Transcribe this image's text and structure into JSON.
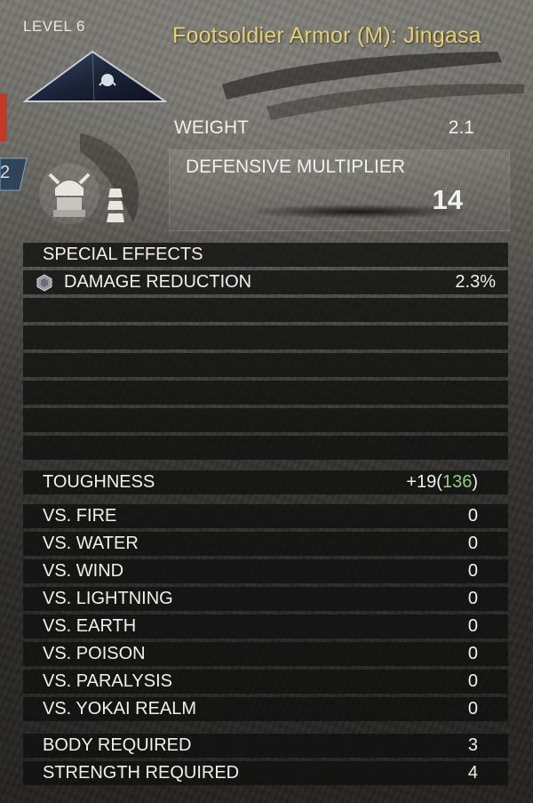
{
  "item": {
    "level_label": "LEVEL 6",
    "title": "Footsoldier Armor (M): Jingasa",
    "side_badge": "2"
  },
  "stats": {
    "weight_label": "WEIGHT",
    "weight_value": "2.1",
    "defense_label": "DEFENSIVE MULTIPLIER",
    "defense_value": "14"
  },
  "special_effects": {
    "header": "SPECIAL EFFECTS",
    "effects": [
      {
        "label": "DAMAGE REDUCTION",
        "value": "2.3%",
        "icon": "effect-gem-icon"
      }
    ]
  },
  "toughness": {
    "label": "TOUGHNESS",
    "bonus": "+19",
    "open_paren": "(",
    "total": "136",
    "close_paren": ")"
  },
  "resistances": [
    {
      "label": "VS. FIRE",
      "value": "0"
    },
    {
      "label": "VS. WATER",
      "value": "0"
    },
    {
      "label": "VS. WIND",
      "value": "0"
    },
    {
      "label": "VS. LIGHTNING",
      "value": "0"
    },
    {
      "label": "VS. EARTH",
      "value": "0"
    },
    {
      "label": "VS. POISON",
      "value": "0"
    },
    {
      "label": "VS. PARALYSIS",
      "value": "0"
    },
    {
      "label": "VS. YOKAI REALM",
      "value": "0"
    }
  ],
  "requirements": [
    {
      "label": "BODY REQUIRED",
      "value": "3"
    },
    {
      "label": "STRENGTH REQUIRED",
      "value": "4"
    }
  ],
  "colors": {
    "title_gold": "#e7cf73",
    "total_green": "#8fd17a",
    "row_background": "#10100f"
  }
}
